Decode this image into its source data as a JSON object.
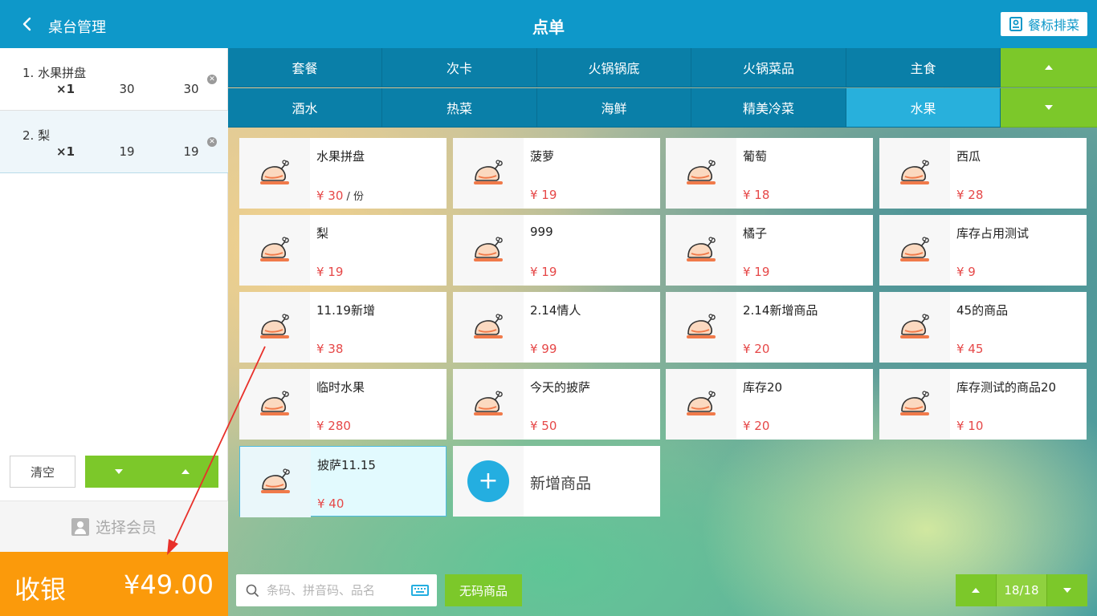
{
  "header": {
    "back_label": "桌台管理",
    "title": "点单",
    "tag_button": "餐标排菜"
  },
  "order": {
    "items": [
      {
        "name": "1. 水果拼盘",
        "qty": "×1",
        "price": "30",
        "total": "30"
      },
      {
        "name": "2. 梨",
        "qty": "×1",
        "price": "19",
        "total": "19"
      }
    ],
    "clear_label": "清空",
    "member_label": "选择会员",
    "checkout_label": "收银",
    "checkout_amount": "¥49.00"
  },
  "categories": {
    "row1": [
      "套餐",
      "次卡",
      "火锅锅底",
      "火锅菜品",
      "主食"
    ],
    "row2": [
      "酒水",
      "热菜",
      "海鲜",
      "精美冷菜",
      "水果"
    ],
    "active": "水果"
  },
  "products": [
    {
      "name": "水果拼盘",
      "price": "¥ 30",
      "unit": " / 份"
    },
    {
      "name": "菠萝",
      "price": "¥ 19"
    },
    {
      "name": "葡萄",
      "price": "¥ 18"
    },
    {
      "name": "西瓜",
      "price": "¥ 28"
    },
    {
      "name": "梨",
      "price": "¥ 19"
    },
    {
      "name": "999",
      "price": "¥ 19"
    },
    {
      "name": "橘子",
      "price": "¥ 19"
    },
    {
      "name": "库存占用测试",
      "price": "¥ 9"
    },
    {
      "name": "11.19新增",
      "price": "¥ 38"
    },
    {
      "name": "2.14情人",
      "price": "¥ 99"
    },
    {
      "name": "2.14新增商品",
      "price": "¥ 20"
    },
    {
      "name": "45的商品",
      "price": "¥ 45"
    },
    {
      "name": "临时水果",
      "price": "¥ 280"
    },
    {
      "name": "今天的披萨",
      "price": "¥ 50"
    },
    {
      "name": "库存20",
      "price": "¥ 20"
    },
    {
      "name": "库存测试的商品20",
      "price": "¥ 10"
    },
    {
      "name": "披萨11.15",
      "price": "¥ 40"
    }
  ],
  "selected_product": "披萨11.15",
  "add_product_label": "新增商品",
  "search": {
    "placeholder": "条码、拼音码、品名",
    "value": ""
  },
  "no_code_label": "无码商品",
  "pager": {
    "label": "18/18"
  },
  "colors": {
    "header": "#0e98c9",
    "category": "#0a7fa8",
    "category_active": "#28b0dc",
    "green": "#7cc82a",
    "checkout": "#fb9a0b",
    "price": "#e64848",
    "annotation_arrow": "#e8302a"
  },
  "icons": {
    "product_thumb": "roast-chicken-icon",
    "back": "chevron-left-icon",
    "tag_button": "menu-card-icon",
    "member": "user-icon",
    "search": "search-icon",
    "keyboard": "keyboard-icon"
  }
}
